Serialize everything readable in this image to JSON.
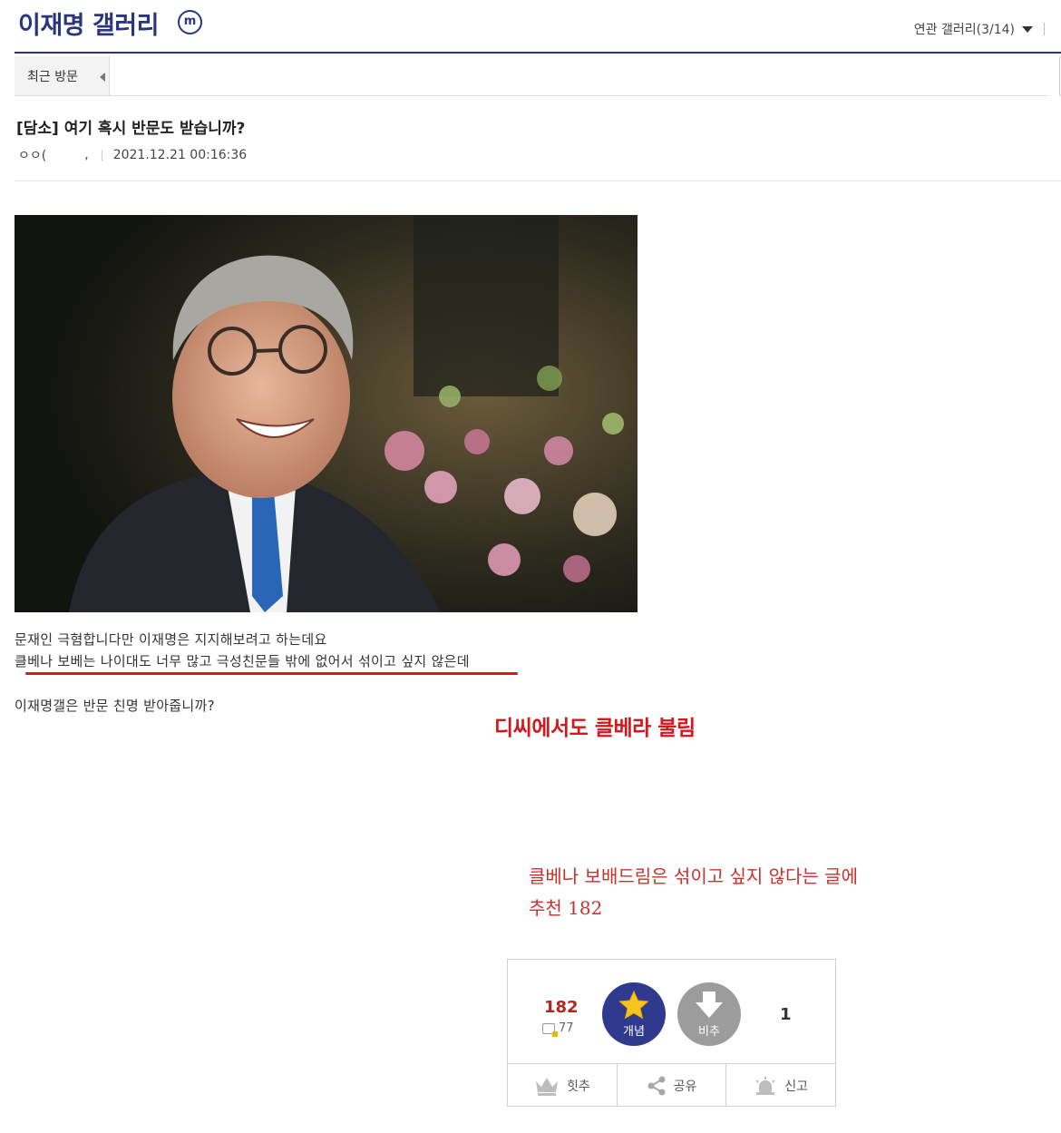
{
  "header": {
    "gallery_title": "이재명 갤러리",
    "badge": "m",
    "related_label": "연관 갤러리(3/14)"
  },
  "recent": {
    "label": "최근 방문"
  },
  "post": {
    "title": "[담소] 여기 혹시 반문도 받습니까?",
    "author": "ㅇㅇ(",
    "author_tail": ",",
    "date": "2021.12.21 00:16:36",
    "lines": [
      "문재인 극혐합니다만 이재명은 지지해보려고 하는데요",
      "클베나 보베는 나이대도 너무 많고 극성친문들 밖에 없어서 섞이고 싶지 않은데",
      "이재명갤은 반문 친명 받아줍니까?"
    ]
  },
  "annotations": {
    "bold": "디씨에서도 클베라 불림",
    "serif_line1": "클베나 보배드림은 섞이고 싶지 않다는 글에",
    "serif_line2": "추천 182"
  },
  "vote": {
    "up_count": "182",
    "fixed_count": "77",
    "up_label": "개념",
    "down_label": "비추",
    "down_count": "1",
    "actions": [
      "힛추",
      "공유",
      "신고"
    ]
  },
  "colors": {
    "brand": "#29367c",
    "annotation_red": "#d8161b",
    "upvote": "#2f3a8f",
    "downvote": "#9c9c9c"
  }
}
